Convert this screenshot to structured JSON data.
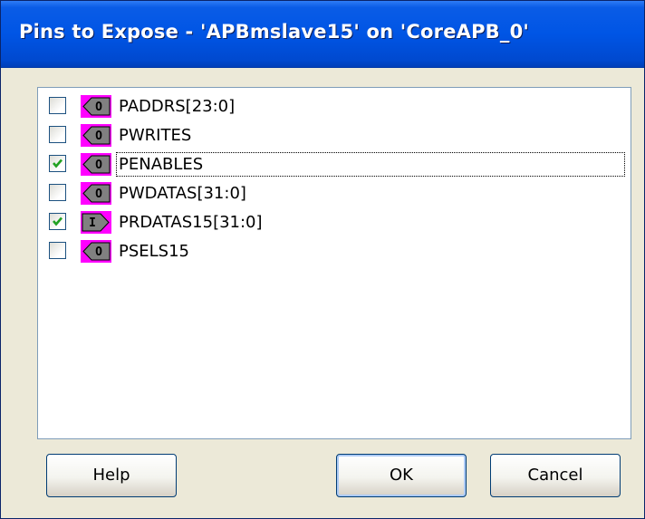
{
  "window": {
    "title": "Pins to Expose - 'APBmslave15' on 'CoreAPB_0'"
  },
  "pins": [
    {
      "label": "PADDRS[23:0]",
      "checked": false,
      "direction": "O",
      "direction_icon": "output-pin-icon"
    },
    {
      "label": "PWRITES",
      "checked": false,
      "direction": "O",
      "direction_icon": "output-pin-icon"
    },
    {
      "label": "PENABLES",
      "checked": true,
      "direction": "O",
      "direction_icon": "output-pin-icon",
      "focused": true
    },
    {
      "label": "PWDATAS[31:0]",
      "checked": false,
      "direction": "O",
      "direction_icon": "output-pin-icon"
    },
    {
      "label": "PRDATAS15[31:0]",
      "checked": true,
      "direction": "I",
      "direction_icon": "input-pin-icon"
    },
    {
      "label": "PSELS15",
      "checked": false,
      "direction": "O",
      "direction_icon": "output-pin-icon"
    }
  ],
  "buttons": {
    "help_label": "Help",
    "ok_label": "OK",
    "cancel_label": "Cancel"
  },
  "colors": {
    "pin_badge": "#ff00ff",
    "pin_icon_fill": "#808080",
    "checkmark": "#21a121",
    "titlebar": "#0055e5"
  }
}
